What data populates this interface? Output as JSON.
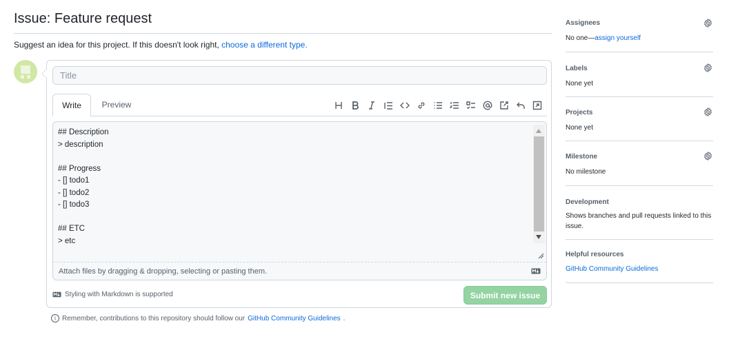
{
  "page": {
    "title": "Issue: Feature request",
    "subtitle_text": "Suggest an idea for this project. If this doesn't look right, ",
    "subtitle_link": "choose a different type.",
    "avatar_icon": "identicon"
  },
  "form": {
    "title_placeholder": "Title",
    "tabs": [
      {
        "label": "Write",
        "active": true
      },
      {
        "label": "Preview",
        "active": false
      }
    ],
    "toolbar_icons": [
      "heading-icon",
      "bold-icon",
      "italic-icon",
      "quote-icon",
      "code-icon",
      "link-icon",
      "unordered-list-icon",
      "ordered-list-icon",
      "task-list-icon",
      "mention-icon",
      "reference-icon",
      "undo-icon",
      "fullscreen-icon"
    ],
    "body_text": "## Description\n> description\n\n## Progress\n- [] todo1\n- [] todo2\n- [] todo3\n\n## ETC\n> etc",
    "attach_text": "Attach files by dragging & dropping, selecting or pasting them.",
    "markdown_note": "Styling with Markdown is supported",
    "submit_label": "Submit new issue",
    "submit_color": "#94d3a2"
  },
  "footer": {
    "remember_text": "Remember, contributions to this repository should follow our ",
    "remember_link": "GitHub Community Guidelines",
    "remember_end": "."
  },
  "sidebar": {
    "assignees": {
      "heading": "Assignees",
      "value_prefix": "No one—",
      "value_link": "assign yourself"
    },
    "labels": {
      "heading": "Labels",
      "value": "None yet"
    },
    "projects": {
      "heading": "Projects",
      "value": "None yet"
    },
    "milestone": {
      "heading": "Milestone",
      "value": "No milestone"
    },
    "development": {
      "heading": "Development",
      "value": "Shows branches and pull requests linked to this issue."
    },
    "helpful": {
      "heading": "Helpful resources",
      "link": "GitHub Community Guidelines"
    }
  },
  "colors": {
    "link": "#0969da",
    "border": "#d0d7de",
    "muted": "#57606a"
  }
}
